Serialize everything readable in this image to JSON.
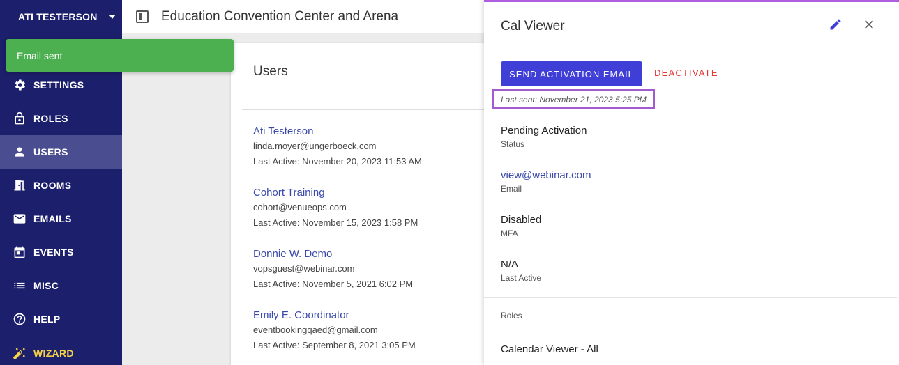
{
  "sidebar": {
    "user_name": "ATI TESTERSON",
    "items": [
      {
        "label": "SETTINGS",
        "icon": "gear-icon"
      },
      {
        "label": "ROLES",
        "icon": "lock-icon"
      },
      {
        "label": "USERS",
        "icon": "person-icon"
      },
      {
        "label": "ROOMS",
        "icon": "door-icon"
      },
      {
        "label": "EMAILS",
        "icon": "envelope-icon"
      },
      {
        "label": "EVENTS",
        "icon": "calendar-icon"
      },
      {
        "label": "MISC",
        "icon": "list-icon"
      },
      {
        "label": "HELP",
        "icon": "help-icon"
      },
      {
        "label": "WIZARD",
        "icon": "magic-wand-icon"
      }
    ],
    "active": "USERS",
    "colors": {
      "bg": "#1c1f6b",
      "active": "#4a4d8f",
      "wizard": "#f4d24a"
    }
  },
  "toast": {
    "message": "Email sent",
    "color": "#4caf50"
  },
  "header": {
    "title": "Education Convention Center and Arena"
  },
  "users_list": {
    "heading": "Users",
    "users": [
      {
        "name": "Ati Testerson",
        "email": "linda.moyer@ungerboeck.com",
        "last_active": "Last Active: November 20, 2023 11:53 AM"
      },
      {
        "name": "Cohort Training",
        "email": "cohort@venueops.com",
        "last_active": "Last Active: November 15, 2023 1:58 PM"
      },
      {
        "name": "Donnie W. Demo",
        "email": "vopsguest@webinar.com",
        "last_active": "Last Active: November 5, 2021 6:02 PM"
      },
      {
        "name": "Emily E. Coordinator",
        "email": "eventbookingqaed@gmail.com",
        "last_active": "Last Active: September 8, 2021 3:05 PM"
      }
    ]
  },
  "detail_panel": {
    "title": "Cal Viewer",
    "send_button": "SEND ACTIVATION EMAIL",
    "deactivate_button": "DEACTIVATE",
    "last_sent": "Last sent: November 21, 2023 5:25 PM",
    "fields": [
      {
        "value": "Pending Activation",
        "label": "Status"
      },
      {
        "value": "view@webinar.com",
        "label": "Email"
      },
      {
        "value": "Disabled",
        "label": "MFA"
      },
      {
        "value": "N/A",
        "label": "Last Active"
      }
    ],
    "roles_label": "Roles",
    "role": "Calendar Viewer - All",
    "accent": "#3f3fd8",
    "highlight": "#a35bd1"
  }
}
